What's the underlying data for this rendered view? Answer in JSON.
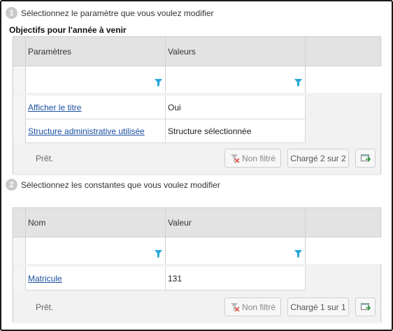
{
  "step1": {
    "number": "1",
    "text": "Sélectionnez le paramètre que vous voulez modifier"
  },
  "section_title": "Objectifs pour l'année à venir",
  "grid1": {
    "columns": [
      "Paramètres",
      "Valeurs"
    ],
    "rows": [
      {
        "param": "Afficher le titre",
        "value": "Oui"
      },
      {
        "param": "Structure administrative utilisée",
        "value": "Structure sélectionnée"
      }
    ],
    "status": "Prêt.",
    "filter_button": "Non filtré",
    "loaded_label": "Chargé 2 sur 2"
  },
  "step2": {
    "number": "2",
    "text": "Sélectionnez les constantes que vous voulez modifier"
  },
  "grid2": {
    "columns": [
      "Nom",
      "Valeur"
    ],
    "rows": [
      {
        "name": "Matricule",
        "value": "131"
      }
    ],
    "status": "Prêt.",
    "filter_button": "Non filtré",
    "loaded_label": "Chargé 1 sur 1"
  },
  "colors": {
    "link": "#1a4fa0",
    "filter_icon": "#2aa7d8",
    "header_bg": "#e3e3e3"
  },
  "icons": {
    "filter": "funnel-icon",
    "clear_filter": "funnel-clear-icon",
    "export": "export-grid-icon"
  }
}
